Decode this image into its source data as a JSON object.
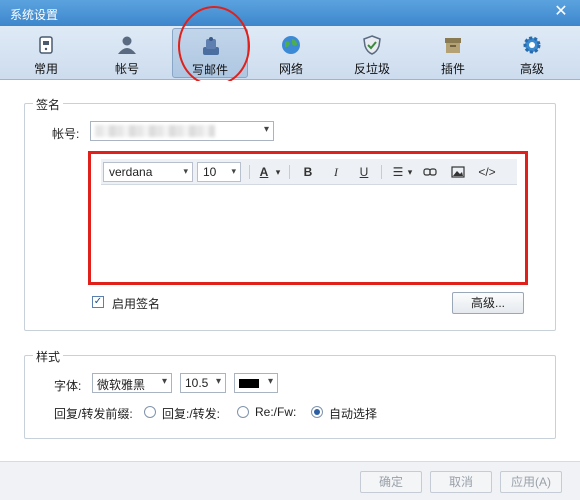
{
  "window": {
    "title": "系统设置"
  },
  "tabs": [
    {
      "label": "常用",
      "icon": "phone-icon"
    },
    {
      "label": "帐号",
      "icon": "user-icon"
    },
    {
      "label": "写邮件",
      "icon": "compose-icon"
    },
    {
      "label": "网络",
      "icon": "globe-icon"
    },
    {
      "label": "反垃圾",
      "icon": "shield-icon"
    },
    {
      "label": "插件",
      "icon": "box-icon"
    },
    {
      "label": "高级",
      "icon": "gear-icon"
    }
  ],
  "signature": {
    "group_label": "签名",
    "account_label": "帐号:",
    "editor": {
      "font_value": "verdana",
      "size_value": "10",
      "text_color_letter": "A",
      "bold": "B",
      "italic": "I",
      "underline": "U",
      "source": "</>"
    },
    "enable_label": "启用签名",
    "advanced_button": "高级..."
  },
  "style": {
    "group_label": "样式",
    "font_label": "字体:",
    "font_value": "微软雅黑",
    "size_value": "10.5",
    "color": "#000000",
    "prefix_label": "回复/转发前缀:",
    "options": [
      "回复:/转发:",
      "Re:/Fw:",
      "自动选择"
    ]
  },
  "footer": {
    "ok": "确定",
    "cancel": "取消",
    "apply": "应用(A)"
  },
  "colors": {
    "accent": "#3d86cc",
    "highlight": "#e0201a"
  }
}
